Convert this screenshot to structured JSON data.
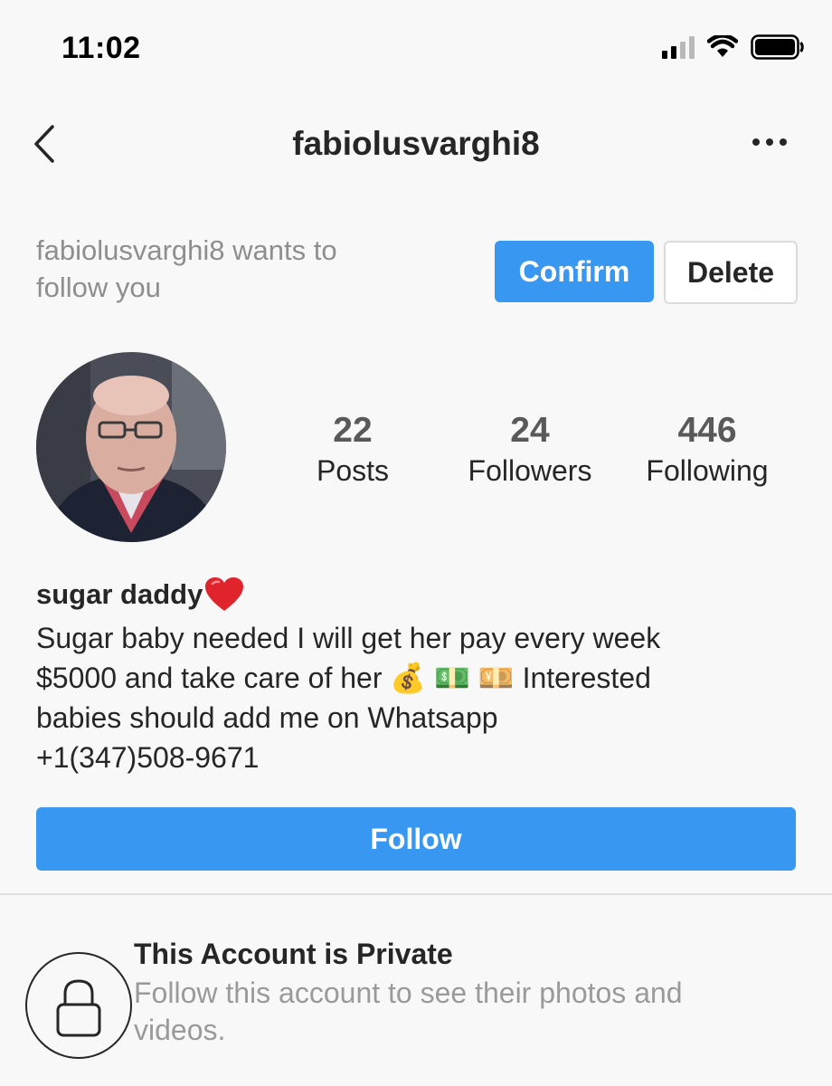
{
  "status_bar": {
    "time": "11:02",
    "icons": [
      "cellular-signal-icon",
      "wifi-icon",
      "battery-icon"
    ]
  },
  "header": {
    "title": "fabiolusvarghi8",
    "back_icon": "chevron-left-icon",
    "more_icon": "more-dots-icon"
  },
  "follow_request": {
    "text": "fabiolusvarghi8 wants to follow you",
    "confirm_label": "Confirm",
    "delete_label": "Delete"
  },
  "profile": {
    "stats": [
      {
        "value": "22",
        "label": "Posts"
      },
      {
        "value": "24",
        "label": "Followers"
      },
      {
        "value": "446",
        "label": "Following"
      }
    ],
    "bio_name": "sugar daddy",
    "bio_text": "Sugar baby needed I will get her pay every week\n$5000 and take care of her 💰 💵 💴  Interested\nbabies should add me on Whatsapp\n+1(347)508-9671",
    "follow_label": "Follow"
  },
  "private_notice": {
    "title": "This Account is Private",
    "subtitle": "Follow this account to see their photos and videos."
  },
  "colors": {
    "accent": "#3897f0",
    "text": "#262626",
    "muted": "#8e8e8e",
    "heart": "#e0242b"
  }
}
